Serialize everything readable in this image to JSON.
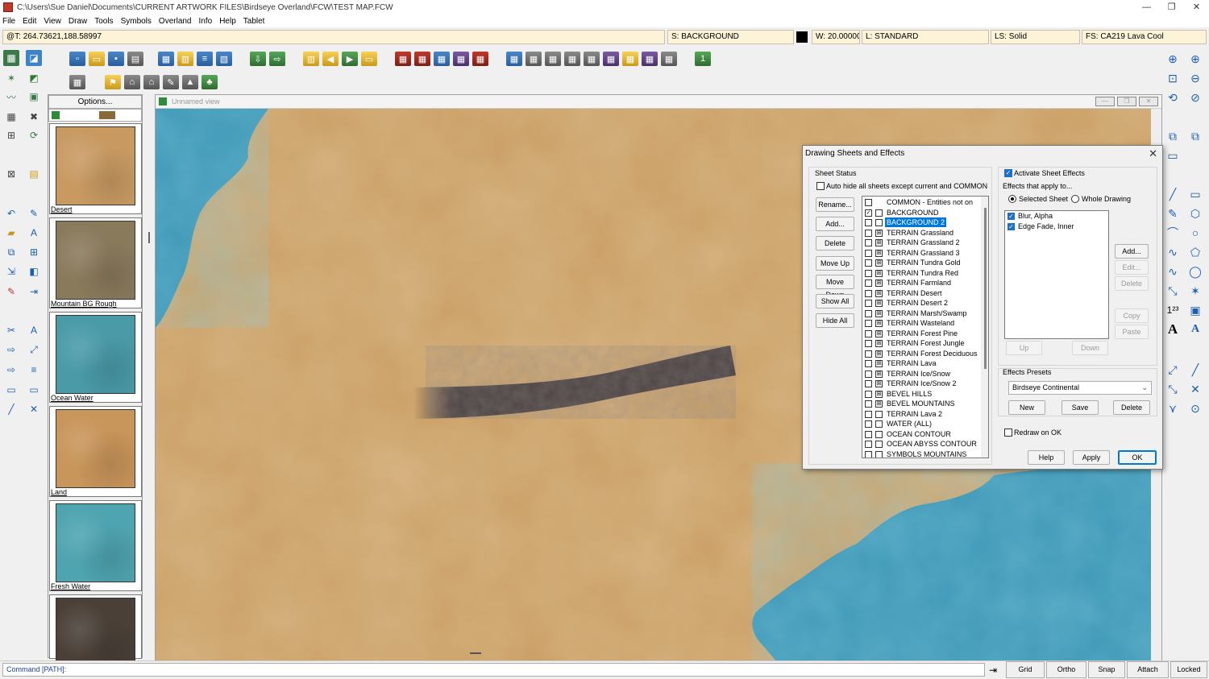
{
  "window": {
    "title": "C:\\Users\\Sue Daniel\\Documents\\CURRENT ARTWORK FILES\\Birdseye Overland\\FCW\\TEST MAP.FCW",
    "minimize": "—",
    "maximize": "❐",
    "close": "✕"
  },
  "menu": [
    "File",
    "Edit",
    "View",
    "Draw",
    "Tools",
    "Symbols",
    "Overland",
    "Info",
    "Help",
    "Tablet"
  ],
  "infobar": {
    "coords": "@T: 264.73621,188.58997",
    "sheet": "S: BACKGROUND",
    "width": "W: 20.00000",
    "layer": "L: STANDARD",
    "linestyle": "LS: Solid",
    "fillstyle": "FS: CA219 Lava Cool"
  },
  "symbols": {
    "options_label": "Options...",
    "items": [
      {
        "label": "Desert",
        "color": "#c89a62"
      },
      {
        "label": "Mountain BG Rough",
        "color": "#8a7a5c"
      },
      {
        "label": "Ocean Water",
        "color": "#4a9aa8"
      },
      {
        "label": "Land",
        "color": "#c8955a"
      },
      {
        "label": "Fresh Water",
        "color": "#4ea4b0"
      },
      {
        "label": "",
        "color": "#4a4038"
      }
    ]
  },
  "mapview": {
    "title": "Unnamed view",
    "colors": {
      "land": "#c79a5e",
      "water": "#3b96b6",
      "path": "#4a4040"
    }
  },
  "dialog": {
    "title": "Drawing Sheets and Effects",
    "close": "✕",
    "sheet_status_label": "Sheet Status",
    "autohide_label": "Auto hide all sheets except current and COMMON",
    "buttons": {
      "rename": "Rename...",
      "add": "Add...",
      "delete": "Delete",
      "moveup": "Move Up",
      "movedown": "Move Down",
      "showall": "Show All",
      "hideall": "Hide All"
    },
    "sheets": [
      {
        "name": "COMMON - Entities not on",
        "visible": false,
        "effects": false
      },
      {
        "name": "BACKGROUND",
        "visible": true,
        "effects": false
      },
      {
        "name": "BACKGROUND 2",
        "visible": false,
        "effects": false,
        "selected": true
      },
      {
        "name": "TERRAIN Grassland",
        "visible": false,
        "effects": true
      },
      {
        "name": "TERRAIN Grassland 2",
        "visible": false,
        "effects": true
      },
      {
        "name": "TERRAIN Grassland 3",
        "visible": false,
        "effects": true
      },
      {
        "name": "TERRAIN Tundra Gold",
        "visible": false,
        "effects": true
      },
      {
        "name": "TERRAIN Tundra Red",
        "visible": false,
        "effects": true
      },
      {
        "name": "TERRAIN Farmland",
        "visible": false,
        "effects": true
      },
      {
        "name": "TERRAIN Desert",
        "visible": false,
        "effects": true
      },
      {
        "name": "TERRAIN Desert 2",
        "visible": false,
        "effects": true
      },
      {
        "name": "TERRAIN Marsh/Swamp",
        "visible": false,
        "effects": true
      },
      {
        "name": "TERRAIN Wasteland",
        "visible": false,
        "effects": true
      },
      {
        "name": "TERRAIN Forest Pine",
        "visible": false,
        "effects": true
      },
      {
        "name": "TERRAIN Forest Jungle",
        "visible": false,
        "effects": true
      },
      {
        "name": "TERRAIN Forest Deciduous",
        "visible": false,
        "effects": true
      },
      {
        "name": "TERRAIN Lava",
        "visible": false,
        "effects": true
      },
      {
        "name": "TERRAIN Ice/Snow",
        "visible": false,
        "effects": true
      },
      {
        "name": "TERRAIN Ice/Snow 2",
        "visible": false,
        "effects": true
      },
      {
        "name": "BEVEL HILLS",
        "visible": false,
        "effects": true
      },
      {
        "name": "BEVEL MOUNTAINS",
        "visible": false,
        "effects": true
      },
      {
        "name": "TERRAIN Lava 2",
        "visible": false,
        "effects": false
      },
      {
        "name": "WATER (ALL)",
        "visible": false,
        "effects": false
      },
      {
        "name": "OCEAN CONTOUR",
        "visible": false,
        "effects": false
      },
      {
        "name": "OCEAN ABYSS CONTOUR",
        "visible": false,
        "effects": false
      },
      {
        "name": "SYMBOLS MOUNTAINS",
        "visible": false,
        "effects": false
      }
    ],
    "activate_effects_label": "Activate Sheet Effects",
    "effects_apply_label": "Effects that apply to...",
    "radio_selected_sheet": "Selected Sheet",
    "radio_whole_drawing": "Whole Drawing",
    "effects": [
      {
        "name": "Blur, Alpha",
        "checked": true
      },
      {
        "name": "Edge Fade, Inner",
        "checked": true
      }
    ],
    "effect_buttons": {
      "add": "Add...",
      "edit": "Edit...",
      "delete": "Delete",
      "copy": "Copy",
      "paste": "Paste",
      "up": "Up",
      "down": "Down"
    },
    "presets_label": "Effects Presets",
    "preset_value": "Birdseye Continental",
    "preset_buttons": {
      "new": "New",
      "save": "Save",
      "delete": "Delete"
    },
    "redraw_label": "Redraw on OK",
    "footer": {
      "help": "Help",
      "apply": "Apply",
      "ok": "OK"
    }
  },
  "command": {
    "prompt": "Command [PATH]:"
  },
  "modes": [
    "Grid",
    "Ortho",
    "Snap",
    "Attach",
    "Locked"
  ]
}
